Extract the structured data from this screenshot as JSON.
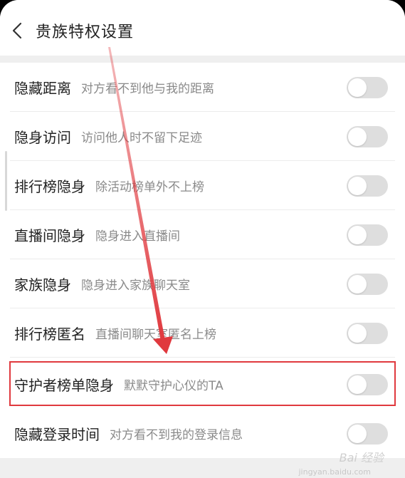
{
  "header": {
    "back_icon": "chevron-left-icon",
    "title": "贵族特权设置"
  },
  "settings": [
    {
      "label": "隐藏距离",
      "desc": "对方看不到他与我的距离",
      "enabled": false
    },
    {
      "label": "隐身访问",
      "desc": "访问他人时不留下足迹",
      "enabled": false
    },
    {
      "label": "排行榜隐身",
      "desc": "除活动榜单外不上榜",
      "enabled": false
    },
    {
      "label": "直播间隐身",
      "desc": "隐身进入直播间",
      "enabled": false
    },
    {
      "label": "家族隐身",
      "desc": "隐身进入家族聊天室",
      "enabled": false
    },
    {
      "label": "排行榜匿名",
      "desc": "直播间聊天室匿名上榜",
      "enabled": false
    },
    {
      "label": "守护者榜单隐身",
      "desc": "默默守护心仪的TA",
      "enabled": false
    },
    {
      "label": "隐藏登录时间",
      "desc": "对方看不到我的登录信息",
      "enabled": false
    }
  ],
  "annotation": {
    "highlight_color": "#e0393e",
    "highlighted_row": "守护者榜单隐身"
  },
  "watermark": {
    "text": "Bai 经验",
    "sub": "jingyan.baidu.com"
  }
}
